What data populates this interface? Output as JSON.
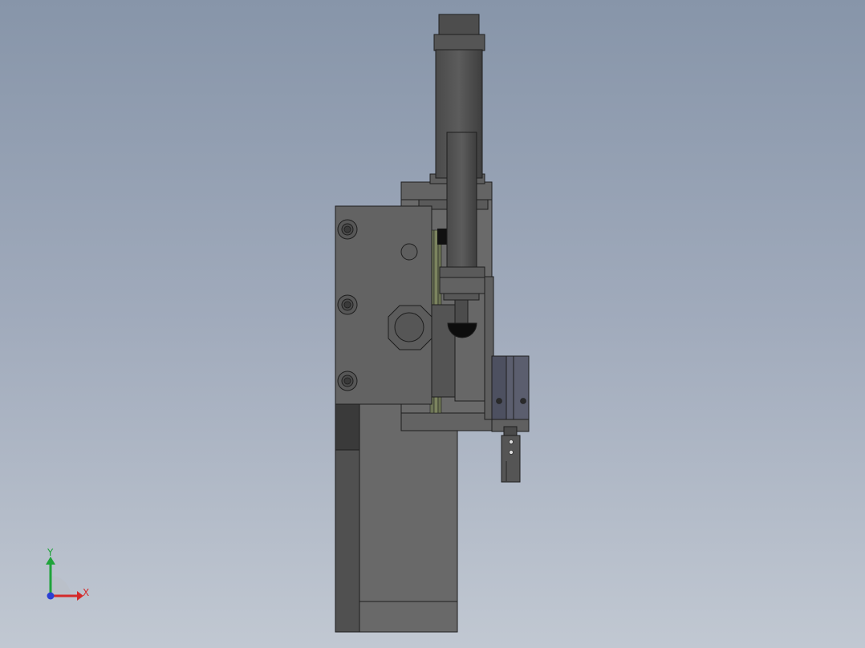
{
  "viewport": {
    "background_top": "#8795a9",
    "background_bottom": "#c1c8d2"
  },
  "triad": {
    "x_label": "X",
    "y_label": "Y",
    "x_color": "#d42a2a",
    "y_color": "#1fa33a",
    "z_color": "#2a3fd4"
  }
}
